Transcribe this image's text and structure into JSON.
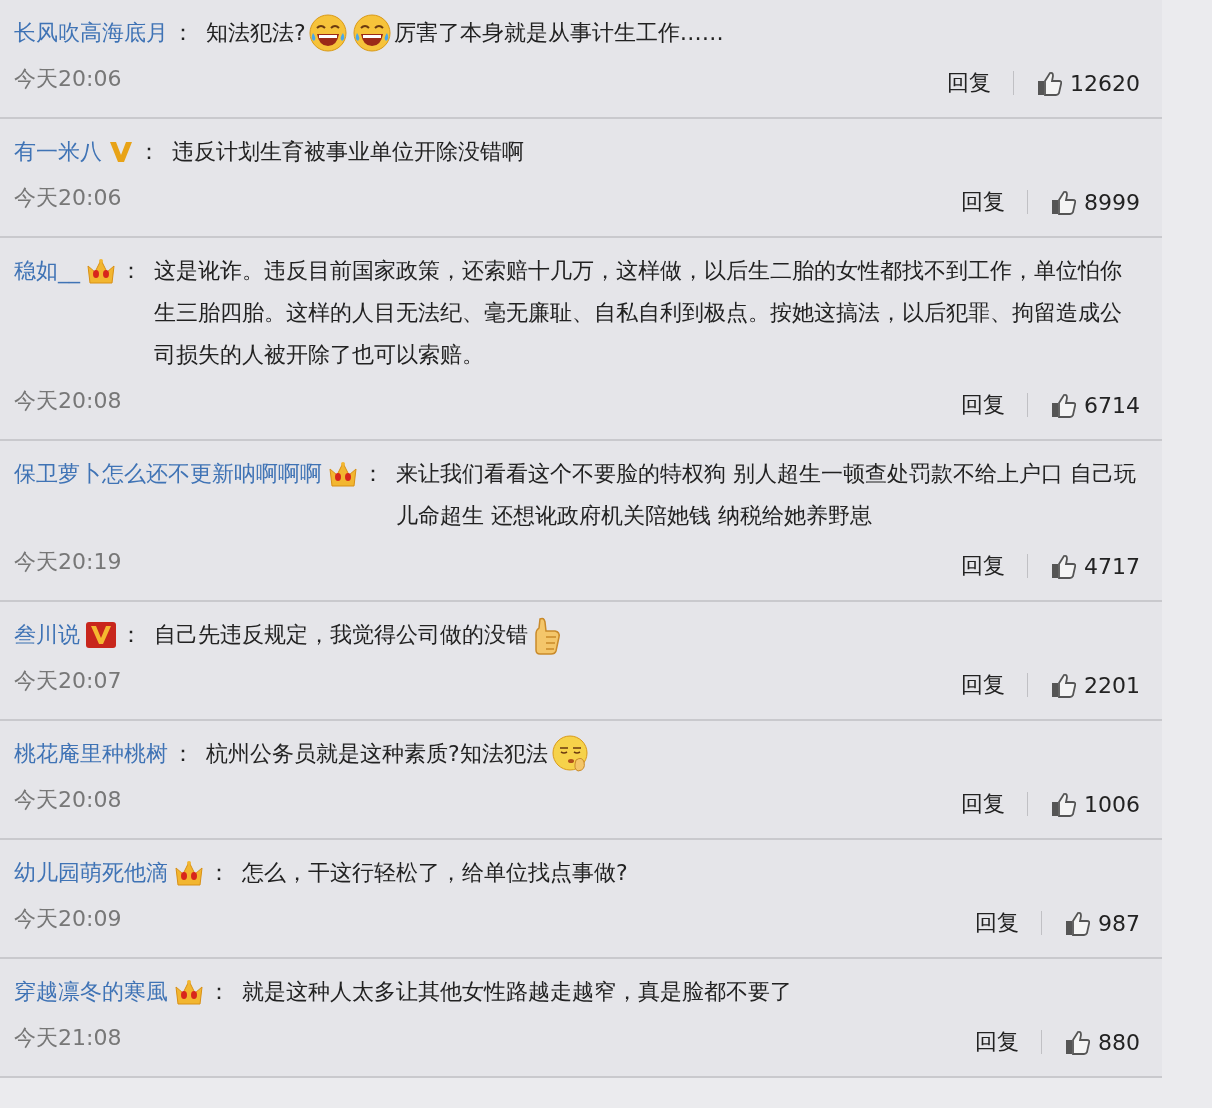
{
  "comments": [
    {
      "user": "长风吹高海底月",
      "separator": "：",
      "content": [
        {
          "kind": "text",
          "text": "知法犯法?"
        },
        {
          "kind": "laugh"
        },
        {
          "kind": "laugh"
        },
        {
          "kind": "text",
          "text": "厉害了本身就是从事计生工作……"
        }
      ],
      "time": "今天20:06",
      "reply": "回复",
      "likes": "12620"
    },
    {
      "user": "有一米八",
      "badge": {
        "kind": "v-gold"
      },
      "separator": "：",
      "content": [
        {
          "kind": "text",
          "text": "违反计划生育被事业单位开除没错啊"
        }
      ],
      "time": "今天20:06",
      "reply": "回复",
      "likes": "8999"
    },
    {
      "user": "稳如__",
      "badge": {
        "kind": "crown"
      },
      "separator": "：",
      "content": [
        {
          "kind": "text",
          "text": "这是讹诈。违反目前国家政策，还索赔十几万，这样做，以后生二胎的女性都找不到工作，单位怕你生三胎四胎。这样的人目无法纪、毫无廉耻、自私自利到极点。按她这搞法，以后犯罪、拘留造成公司损失的人被开除了也可以索赔。"
        }
      ],
      "time": "今天20:08",
      "reply": "回复",
      "likes": "6714"
    },
    {
      "user": "保卫萝卜怎么还不更新呐啊啊啊",
      "badge": {
        "kind": "crown"
      },
      "separator": "：",
      "content": [
        {
          "kind": "text",
          "text": "来让我们看看这个不要脸的特权狗 别人超生一顿查处罚款不给上户口 自己玩儿命超生 还想讹政府机关陪她钱 纳税给她养野崽"
        }
      ],
      "time": "今天20:19",
      "reply": "回复",
      "likes": "4717"
    },
    {
      "user": "叁川说",
      "badge": {
        "kind": "v-red"
      },
      "separator": "：",
      "content": [
        {
          "kind": "text",
          "text": "自己先违反规定，我觉得公司做的没错"
        },
        {
          "kind": "thumb"
        }
      ],
      "time": "今天20:07",
      "reply": "回复",
      "likes": "2201"
    },
    {
      "user": "桃花庵里种桃树",
      "separator": "：",
      "content": [
        {
          "kind": "text",
          "text": "杭州公务员就是这种素质?知法犯法"
        },
        {
          "kind": "shush"
        }
      ],
      "time": "今天20:08",
      "reply": "回复",
      "likes": "1006"
    },
    {
      "user": "幼儿园萌死他滴",
      "badge": {
        "kind": "crown"
      },
      "separator": "：",
      "content": [
        {
          "kind": "text",
          "text": "怎么，干这行轻松了，给单位找点事做?"
        }
      ],
      "time": "今天20:09",
      "reply": "回复",
      "likes": "987"
    },
    {
      "user": "穿越凛冬的寒風",
      "badge": {
        "kind": "crown"
      },
      "separator": "：",
      "content": [
        {
          "kind": "text",
          "text": "就是这种人太多让其他女性路越走越窄，真是脸都不要了"
        }
      ],
      "time": "今天21:08",
      "reply": "回复",
      "likes": "880"
    }
  ]
}
